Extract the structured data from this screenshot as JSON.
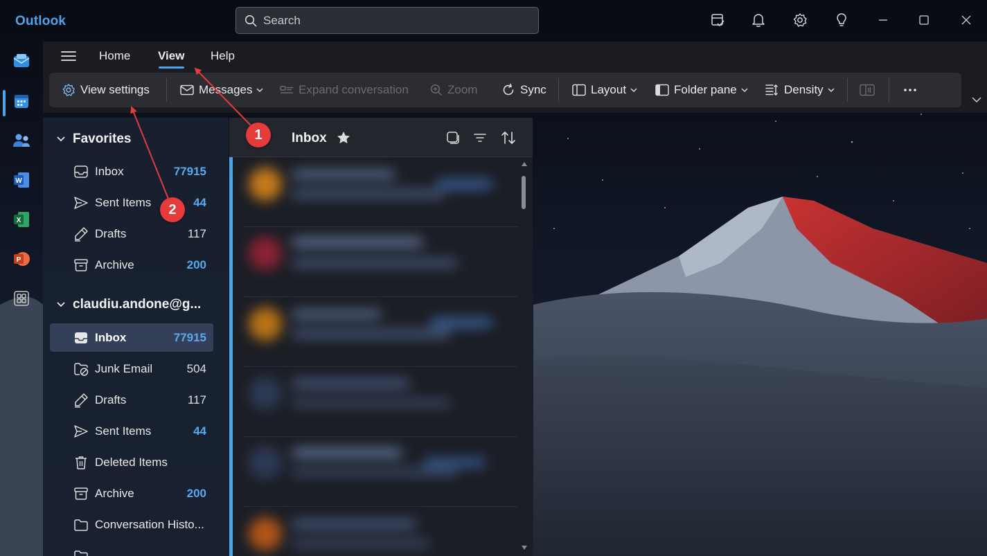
{
  "app": {
    "title": "Outlook"
  },
  "search": {
    "placeholder": "Search"
  },
  "titlebar_icons": [
    "my-day-icon",
    "bell-icon",
    "gear-icon",
    "lightbulb-icon",
    "minimize-icon",
    "maximize-icon",
    "close-icon"
  ],
  "rail": [
    "mail-icon",
    "calendar-icon",
    "people-icon",
    "word-icon",
    "excel-icon",
    "powerpoint-icon",
    "apps-icon"
  ],
  "ribbon": {
    "tabs": [
      {
        "label": "Home",
        "selected": false
      },
      {
        "label": "View",
        "selected": true
      },
      {
        "label": "Help",
        "selected": false
      }
    ],
    "tools": {
      "view_settings": "View settings",
      "messages": "Messages",
      "expand_conversation": "Expand conversation",
      "zoom": "Zoom",
      "sync": "Sync",
      "layout": "Layout",
      "folder_pane": "Folder pane",
      "density": "Density"
    }
  },
  "favorites": {
    "title": "Favorites",
    "items": [
      {
        "label": "Inbox",
        "count": "77915",
        "highlight": true
      },
      {
        "label": "Sent Items",
        "count": "44",
        "highlight": true
      },
      {
        "label": "Drafts",
        "count": "117",
        "highlight": false
      },
      {
        "label": "Archive",
        "count": "200",
        "highlight": true
      }
    ]
  },
  "account": {
    "title": "claudiu.andone@g...",
    "items": [
      {
        "label": "Inbox",
        "count": "77915",
        "highlight": true
      },
      {
        "label": "Junk Email",
        "count": "504",
        "highlight": false
      },
      {
        "label": "Drafts",
        "count": "117",
        "highlight": false
      },
      {
        "label": "Sent Items",
        "count": "44",
        "highlight": true
      },
      {
        "label": "Deleted Items",
        "count": "",
        "highlight": false
      },
      {
        "label": "Archive",
        "count": "200",
        "highlight": true
      },
      {
        "label": "Conversation Histo...",
        "count": "",
        "highlight": false
      }
    ]
  },
  "message_list": {
    "title": "Inbox"
  },
  "annotations": {
    "badge1": "1",
    "badge2": "2"
  },
  "colors": {
    "accent": "#4fa4e8",
    "badge": "#e53b3b",
    "count_blue": "#58a9ef"
  }
}
